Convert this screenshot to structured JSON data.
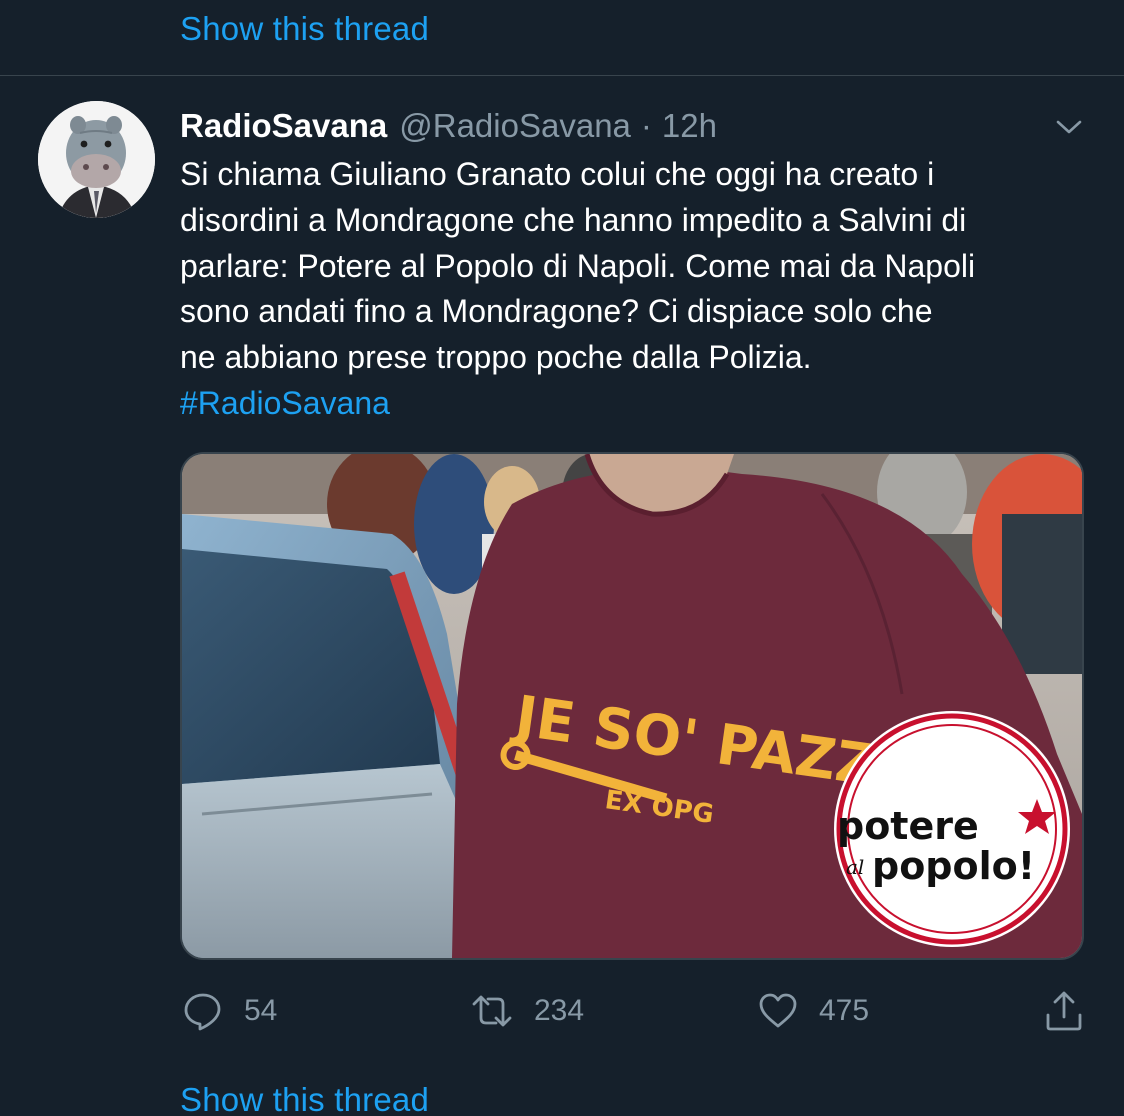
{
  "thread_link_top": "Show this thread",
  "thread_link_bottom": "Show this thread",
  "tweet": {
    "display_name": "RadioSavana",
    "handle": "@RadioSavana",
    "separator": "·",
    "time": "12h",
    "text_lines": [
      "Si chiama Giuliano Granato colui che oggi ha creato i",
      "disordini a Mondragone che hanno impedito a Salvini di",
      "parlare: Potere al Popolo di Napoli. Come mai da Napoli",
      "sono andati fino a Mondragone? Ci dispiace solo che",
      "ne abbiano prese troppo poche dalla Polizia."
    ],
    "hashtag": "#RadioSavana"
  },
  "media": {
    "shirt_print": "JE SO' PAZZO",
    "shirt_subprint": "EX OPG",
    "logo_line1": "potere",
    "logo_line2_small": "al",
    "logo_line2": "popolo!"
  },
  "actions": {
    "replies": "54",
    "retweets": "234",
    "likes": "475"
  },
  "colors": {
    "background": "#15202b",
    "accent": "#1da1f2",
    "secondary_text": "#8899a6",
    "divider": "#38444d",
    "shirt": "#6d2a3c",
    "print": "#f2b33a",
    "logo_red": "#c8102e"
  },
  "icons": {
    "reply": "reply-icon",
    "retweet": "retweet-icon",
    "like": "heart-icon",
    "share": "share-icon",
    "menu": "chevron-down-icon"
  }
}
